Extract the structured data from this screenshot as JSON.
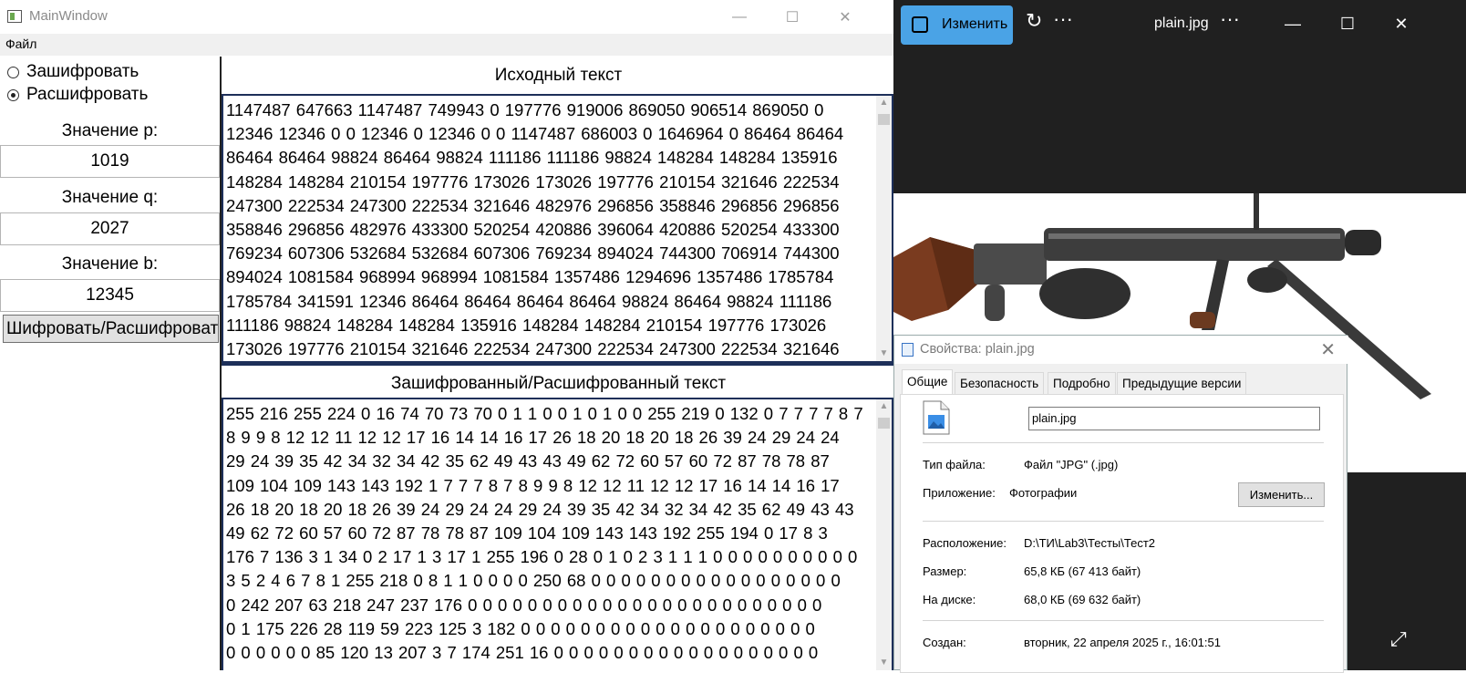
{
  "main_window": {
    "title": "MainWindow",
    "controls": {
      "minimize": "—",
      "maximize": "☐",
      "close": "✕"
    },
    "menu": {
      "file": "Файл"
    },
    "mode": {
      "encrypt_label": "Зашифровать",
      "decrypt_label": "Расшифровать",
      "selected": "decrypt"
    },
    "params": {
      "p_label": "Значение p:",
      "p_value": "1019",
      "q_label": "Значение q:",
      "q_value": "2027",
      "b_label": "Значение b:",
      "b_value": "12345"
    },
    "run_button": "Шифровать/Расшифровать",
    "source": {
      "header": "Исходный текст",
      "text": "1147487 647663 1147487 749943 0 197776 919006 869050 906514 869050 0\n12346 12346 0 0 12346 0 12346 0 0 1147487 686003 0 1646964 0 86464 86464\n86464 86464 98824 86464 98824 111186 111186 98824 148284 148284 135916\n148284 148284 210154 197776 173026 173026 197776 210154 321646 222534\n247300 222534 247300 222534 321646 482976 296856 358846 296856 296856\n358846 296856 482976 433300 520254 420886 396064 420886 520254 433300\n769234 607306 532684 532684 607306 769234 894024 744300 706914 744300\n894024 1081584 968994 968994 1081584 1357486 1294696 1357486 1785784\n1785784 341591 12346 86464 86464 86464 86464 98824 86464 98824 111186\n111186 98824 148284 148284 135916 148284 148284 210154 197776 173026\n173026 197776 210154 321646 222534 247300 222534 247300 222534 321646"
    },
    "result": {
      "header": "Зашифрованный/Расшифрованный текст",
      "text": "255 216 255 224 0 16 74 70 73 70 0 1 1 0 0 1 0 1 0 0 255 219 0 132 0 7 7 7 7 8 7\n8 9 9 8 12 12 11 12 12 17 16 14 14 16 17 26 18 20 18 20 18 26 39 24 29 24 24\n29 24 39 35 42 34 32 34 42 35 62 49 43 43 49 62 72 60 57 60 72 87 78 78 87\n109 104 109 143 143 192 1 7 7 7 8 7 8 9 9 8 12 12 11 12 12 17 16 14 14 16 17\n26 18 20 18 20 18 26 39 24 29 24 24 29 24 39 35 42 34 32 34 42 35 62 49 43 43\n49 62 72 60 57 60 72 87 78 78 87 109 104 109 143 143 192 255 194 0 17 8 3\n176 7 136 3 1 34 0 2 17 1 3 17 1 255 196 0 28 0 1 0 2 3 1 1 1 0 0 0 0 0 0 0 0 0 0\n3 5 2 4 6 7 8 1 255 218 0 8 1 1 0 0 0 0 250 68 0 0 0 0 0 0 0 0 0 0 0 0 0 0 0 0 0\n0 242 207 63 218 247 237 176 0 0 0 0 0 0 0 0 0 0 0 0 0 0 0 0 0 0 0 0 0 0 0 0\n0 1 175 226 28 119 59 223 125 3 182 0 0 0 0 0 0 0 0 0 0 0 0 0 0 0 0 0 0 0 0\n0 0 0 0 0 0 85 120 13 207 3 7 174 251 16 0 0 0 0 0 0 0 0 0 0 0 0 0 0 0 0 0 0"
    }
  },
  "photos_app": {
    "edit_button": "Изменить",
    "file_name": "plain.jpg",
    "more": "···",
    "controls": {
      "minimize": "—",
      "maximize": "☐",
      "close": "✕"
    }
  },
  "properties_dialog": {
    "title": "Свойства: plain.jpg",
    "close": "✕",
    "tabs": [
      "Общие",
      "Безопасность",
      "Подробно",
      "Предыдущие версии"
    ],
    "active_tab": "Общие",
    "file_name_value": "plain.jpg",
    "rows": {
      "type_label": "Тип файла:",
      "type_value": "Файл \"JPG\" (.jpg)",
      "app_label": "Приложение:",
      "app_value": "Фотографии",
      "change_button": "Изменить...",
      "location_label": "Расположение:",
      "location_value": "D:\\ТИ\\Lab3\\Тесты\\Тест2",
      "size_label": "Размер:",
      "size_value": "65,8 КБ (67 413 байт)",
      "disk_label": "На диске:",
      "disk_value": "68,0 КБ (69 632 байт)",
      "created_label": "Создан:",
      "created_value": "вторник, 22 апреля 2025 г., 16:01:51"
    }
  }
}
